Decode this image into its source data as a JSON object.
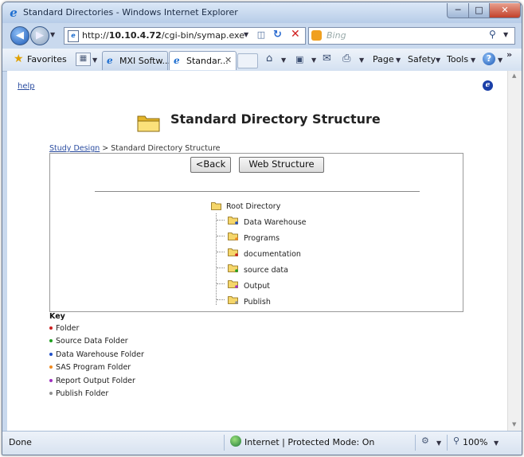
{
  "window": {
    "title": "Standard Directories - Windows Internet Explorer"
  },
  "address_bar": {
    "url_prefix": "http://",
    "url_host": "10.10.4.72",
    "url_path": "/cgi-bin/symap.exe"
  },
  "search": {
    "placeholder": "Bing"
  },
  "favorites": {
    "label": "Favorites"
  },
  "tabs": [
    {
      "label": "MXI Softw..."
    },
    {
      "label": "Standar...",
      "active": true
    }
  ],
  "command_bar": {
    "page": "Page",
    "safety": "Safety",
    "tools": "Tools"
  },
  "page": {
    "help_link": "help",
    "title": "Standard Directory Structure",
    "breadcrumb": {
      "link": "Study Design",
      "separator": " > ",
      "current": "Standard Directory Structure"
    },
    "buttons": {
      "back": "<Back",
      "web_structure": "Web Structure"
    },
    "tree": {
      "root": "Root Directory",
      "children": [
        {
          "label": "Data Warehouse",
          "marker": "blue"
        },
        {
          "label": "Programs",
          "marker": "orange"
        },
        {
          "label": "documentation",
          "marker": "red"
        },
        {
          "label": "source data",
          "marker": "green"
        },
        {
          "label": "Output",
          "marker": "purple"
        },
        {
          "label": "Publish",
          "marker": "gray"
        }
      ]
    },
    "key": {
      "title": "Key",
      "items": [
        {
          "label": "Folder",
          "color": "#cc2020"
        },
        {
          "label": "Source Data Folder",
          "color": "#20a020"
        },
        {
          "label": "Data Warehouse Folder",
          "color": "#2050c8"
        },
        {
          "label": "SAS Program Folder",
          "color": "#f08a20"
        },
        {
          "label": "Report Output Folder",
          "color": "#a030c0"
        },
        {
          "label": "Publish Folder",
          "color": "#909090"
        }
      ]
    }
  },
  "status_bar": {
    "status": "Done",
    "zone": "Internet | Protected Mode: On",
    "zoom": "100%"
  },
  "colors": {
    "marker_red": "#cc2020",
    "marker_green": "#20a020",
    "marker_blue": "#2050c8",
    "marker_orange": "#f08a20",
    "marker_purple": "#a030c0",
    "marker_gray": "#909090",
    "link": "#2a4ca0"
  },
  "icons": [
    "ie-icon",
    "back-arrow-icon",
    "forward-arrow-icon",
    "page-icon",
    "compat-view-icon",
    "refresh-icon",
    "stop-icon",
    "bing-icon",
    "search-icon",
    "favorites-star-icon",
    "tab-grid-icon",
    "new-tab-icon",
    "home-icon",
    "feeds-icon",
    "mail-icon",
    "print-icon",
    "help-icon",
    "folder-icon",
    "globe-icon",
    "zoom-icon"
  ]
}
